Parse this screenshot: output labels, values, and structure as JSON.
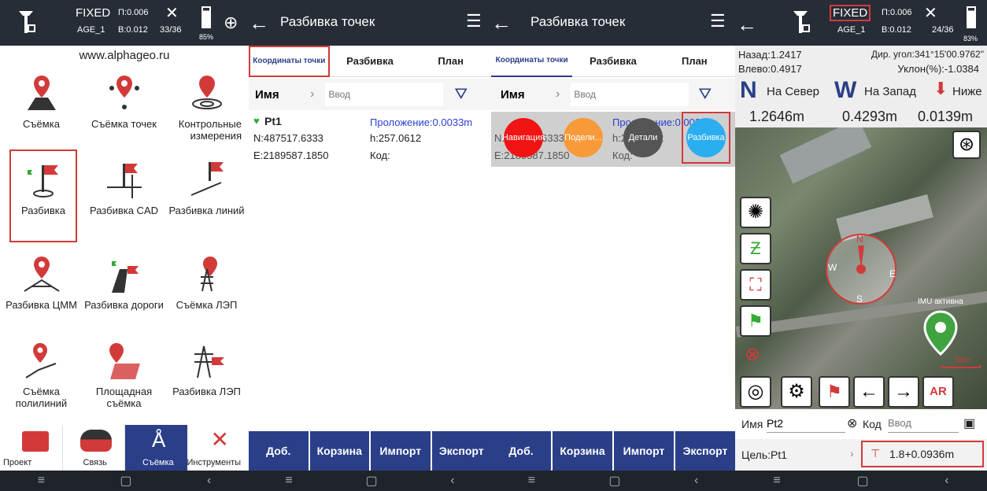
{
  "p1": {
    "status": {
      "fix": "FIXED",
      "age": "AGE_1",
      "p": "П:0.006",
      "b": "В:0.012",
      "sats": "33/36",
      "battery": "85%"
    },
    "site": "www.alphageo.ru",
    "items": [
      {
        "label": "Съёмка"
      },
      {
        "label": "Съёмка точек"
      },
      {
        "label": "Контрольные измерения"
      },
      {
        "label": "Разбивка"
      },
      {
        "label": "Разбивка CAD"
      },
      {
        "label": "Разбивка линий"
      },
      {
        "label": "Разбивка ЦММ"
      },
      {
        "label": "Разбивка дороги"
      },
      {
        "label": "Съёмка ЛЭП"
      },
      {
        "label": "Съёмка полилиний"
      },
      {
        "label": "Площадная съёмка"
      },
      {
        "label": "Разбивка ЛЭП"
      }
    ],
    "bottom": [
      {
        "label": "Проект"
      },
      {
        "label": "Связь"
      },
      {
        "label": "Съёмка"
      },
      {
        "label": "Инструменты"
      }
    ]
  },
  "p2": {
    "title": "Разбивка точек",
    "tabs": [
      "Координаты точки",
      "Разбивка",
      "План"
    ],
    "name_label": "Имя",
    "input_placeholder": "Ввод",
    "point": {
      "name": "Pt1",
      "n": "N:487517.6333",
      "e": "E:2189587.1850",
      "dist": "Проложение:0.0033m",
      "h": "h:257.0612",
      "code": "Код:"
    },
    "buttons": [
      "Доб.",
      "Корзина",
      "Импорт",
      "Экспорт"
    ]
  },
  "p3": {
    "title": "Разбивка точек",
    "tabs": [
      "Координаты точки",
      "Разбивка",
      "План"
    ],
    "name_label": "Имя",
    "input_placeholder": "Ввод",
    "row": {
      "n": "N:487517.6333",
      "e": "E:2189587.1850",
      "dist": "Проложение:0.0033m",
      "h": "h:257.0612",
      "code": "Код:"
    },
    "actions": [
      "Навигация",
      "Подели...",
      "Детали",
      "Разбивка"
    ],
    "buttons": [
      "Доб.",
      "Корзина",
      "Импорт",
      "Экспорт"
    ]
  },
  "p4": {
    "status": {
      "fix": "FIXED",
      "age": "AGE_1",
      "p": "П:0.006",
      "b": "В:0.012",
      "sats": "24/36",
      "battery": "83%"
    },
    "back": "Назад:1.2417",
    "left": "Влево:0.4917",
    "dir": "Дир. угол:341°15'00.9762\"",
    "slope": "Уклон(%):-1.0384",
    "north": "На Север",
    "west": "На Запад",
    "lower": "Ниже",
    "v1": "1.2646m",
    "v2": "0.4293m",
    "v3": "0.0139m",
    "imu": "IMU активна",
    "scale": "50m",
    "name_label": "Имя",
    "name_value": "Pt2",
    "code_label": "Код",
    "code_placeholder": "Ввод",
    "target": "Цель:Pt1",
    "height": "1.8+0.0936m"
  },
  "colors": {
    "status": "#262d37",
    "blue": "#2a3f88",
    "red": "#d23a3a"
  }
}
